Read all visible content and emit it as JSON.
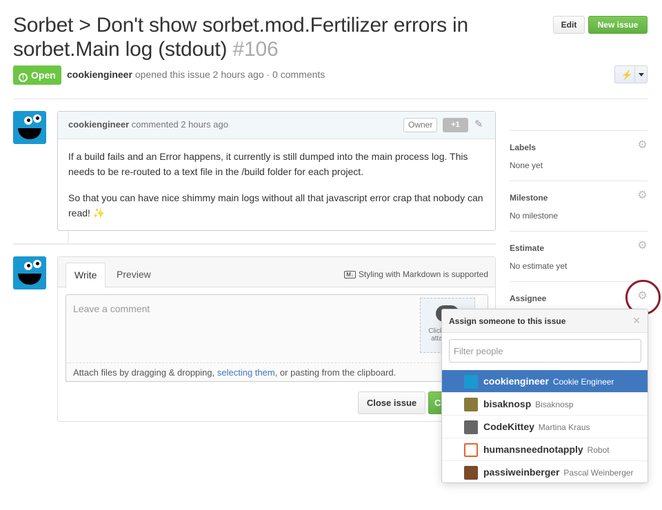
{
  "header": {
    "title": "Sorbet > Don't show sorbet.mod.Fertilizer errors in sorbet.Main log (stdout)",
    "number": "#106",
    "edit_label": "Edit",
    "new_issue_label": "New issue",
    "state": "Open",
    "author": "cookiengineer",
    "opened_text": "opened this issue 2 hours ago · 0 comments"
  },
  "comment": {
    "author": "cookiengineer",
    "time_text": "commented 2 hours ago",
    "owner_badge": "Owner",
    "plus_one": "+1",
    "paragraph1": "If a build fails and an Error happens, it currently is still dumped into the main process log. This needs to be re-routed to a text file in the /build folder for each project.",
    "paragraph2": "So that you can have nice shimmy main logs without all that javascript error crap that nobody can read! ✨"
  },
  "form": {
    "tab_write": "Write",
    "tab_preview": "Preview",
    "markdown_note": "Styling with Markdown is supported",
    "placeholder": "Leave a comment",
    "dropzone_text": "Click here to attach files",
    "attach_prefix": "Attach files by dragging & dropping, ",
    "attach_link": "selecting them",
    "attach_suffix": ", or pasting from the clipboard.",
    "close_label": "Close issue",
    "comment_label": "C"
  },
  "sidebar": {
    "labels": {
      "title": "Labels",
      "value": "None yet"
    },
    "milestone": {
      "title": "Milestone",
      "value": "No milestone"
    },
    "estimate": {
      "title": "Estimate",
      "value": "No estimate yet"
    },
    "assignee": {
      "title": "Assignee"
    }
  },
  "assign_dropdown": {
    "title": "Assign someone to this issue",
    "filter_placeholder": "Filter people",
    "people": [
      {
        "login": "cookiengineer",
        "name": "Cookie Engineer",
        "selected": true
      },
      {
        "login": "bisaknosp",
        "name": "Bisaknosp"
      },
      {
        "login": "CodeKittey",
        "name": "Martina Kraus"
      },
      {
        "login": "humansneednotapply",
        "name": "Robot"
      },
      {
        "login": "passiweinberger",
        "name": "Pascal Weinberger"
      }
    ]
  },
  "colors": {
    "open_green": "#6cc644",
    "selected_blue": "#4078c0",
    "avatar_blue": "#1a98d0",
    "highlight_ring": "#8c1c2c"
  }
}
